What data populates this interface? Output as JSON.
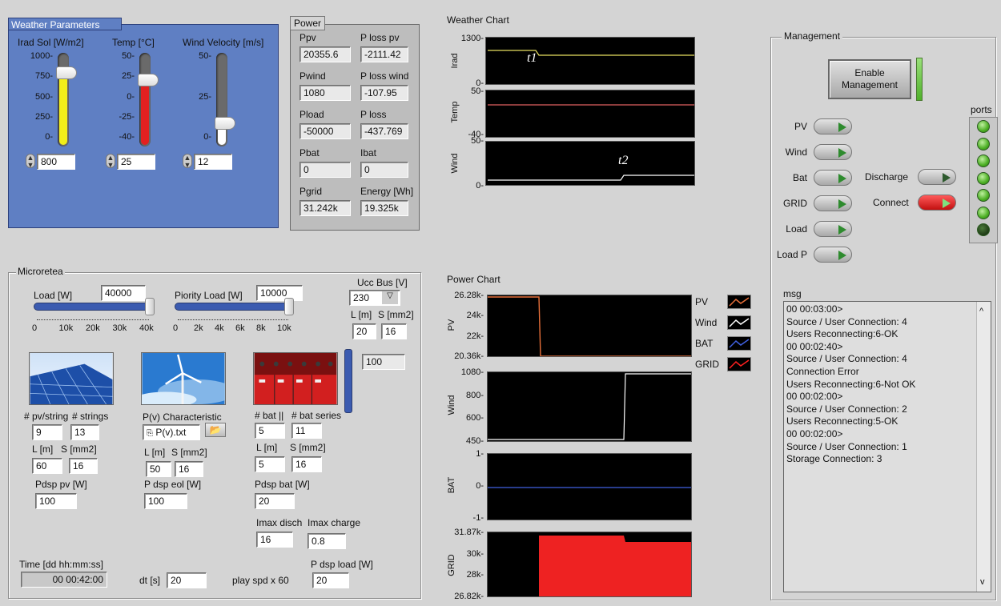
{
  "weather": {
    "title": "Weather Parameters",
    "irad": {
      "label": "Irad Sol [W/m2]",
      "value": "800",
      "ticks": [
        "1000-",
        "750-",
        "500-",
        "250-",
        "0-"
      ],
      "level": 0.8,
      "color": "#f2ef1a"
    },
    "temp": {
      "label": "Temp [°C]",
      "value": "25",
      "ticks": [
        "50-",
        "25-",
        "0-",
        "-25-",
        "-40-"
      ],
      "level": 0.72,
      "color": "#e22020"
    },
    "wind": {
      "label": "Wind Velocity [m/s]",
      "value": "12",
      "ticks": [
        "50-",
        "25-",
        "0-"
      ],
      "level": 0.24,
      "color": "#ffffff"
    }
  },
  "power": {
    "title": "Power",
    "items": [
      {
        "label": "Ppv",
        "value": "20355.6"
      },
      {
        "label": "P loss pv",
        "value": "-2111.42"
      },
      {
        "label": "Pwind",
        "value": "1080"
      },
      {
        "label": "P loss wind",
        "value": "-107.95"
      },
      {
        "label": "Pload",
        "value": "-50000"
      },
      {
        "label": "P loss",
        "value": "-437.769"
      },
      {
        "label": "Pbat",
        "value": "0"
      },
      {
        "label": "Ibat",
        "value": "0"
      },
      {
        "label": "Pgrid",
        "value": "31.242k"
      },
      {
        "label": "Energy [Wh]",
        "value": "19.325k"
      }
    ]
  },
  "weather_chart": {
    "title": "Weather Chart",
    "irad": {
      "ylabel": "Irad",
      "top": "1300-",
      "bottom": "0-",
      "annot": "t1",
      "color": "#e8e060"
    },
    "temp": {
      "ylabel": "Temp",
      "top": "50-",
      "bottom": "-40-",
      "color": "#e06060"
    },
    "wind": {
      "ylabel": "Wind",
      "top": "50-",
      "bottom": "0-",
      "annot": "t2",
      "color": "#ffffff"
    }
  },
  "management": {
    "title": "Management",
    "enable_label": "Enable Management",
    "ports_label": "ports",
    "sources": [
      "PV",
      "Wind",
      "Bat",
      "GRID",
      "Load",
      "Load P"
    ],
    "discharge_label": "Discharge",
    "connect_label": "Connect",
    "msg_label": "msg",
    "msg_lines": [
      "00 00:03:00>",
      "Source / User Connection: 4",
      "Users Reconnecting:6-OK",
      "00 00:02:40>",
      "Source / User Connection: 4",
      "Connection Error",
      "Users Reconnecting:6-Not OK",
      "00 00:02:00>",
      "Source / User Connection: 2",
      "Users Reconnecting:5-OK",
      "00 00:02:00>",
      "Source / User Connection: 1",
      "Storage Connection: 3"
    ],
    "scroll_up": "^",
    "scroll_down": "v"
  },
  "micro": {
    "title": "Microretea",
    "load_label": "Load [W]",
    "load_value": "40000",
    "load_level": 1.0,
    "load_ticks": [
      "0",
      "10k",
      "20k",
      "30k",
      "40k"
    ],
    "prio_label": "Piority Load [W]",
    "prio_value": "10000",
    "prio_level": 1.0,
    "prio_ticks": [
      "0",
      "2k",
      "4k",
      "6k",
      "8k",
      "10k"
    ],
    "ucc_label": "Ucc Bus [V]",
    "ucc_value": "230",
    "ucc_l_label": "L [m]",
    "ucc_s_label": "S [mm2]",
    "ucc_l": "20",
    "ucc_s": "16",
    "bat_level_value": "100",
    "pv_string_label": "# pv/string",
    "strings_label": "# strings",
    "pv_string": "9",
    "strings": "13",
    "pv_l_label": "L [m]",
    "pv_s_label": "S [mm2]",
    "pv_l": "60",
    "pv_s": "16",
    "pdsp_pv_label": "Pdsp pv [W]",
    "pdsp_pv": "100",
    "pv_char_label": "P(v) Characteristic",
    "pv_file": "P(v).txt",
    "eol_l_label": "L [m]",
    "eol_s_label": "S [mm2]",
    "eol_l": "50",
    "eol_s": "16",
    "pdsp_eol_label": "P dsp eol [W]",
    "pdsp_eol": "100",
    "bat_par_label": "# bat ||",
    "bat_ser_label": "# bat series",
    "bat_par": "5",
    "bat_ser": "11",
    "bat_l_label": "L [m]",
    "bat_s_label": "S [mm2]",
    "bat_l": "5",
    "bat_s": "16",
    "pdsp_bat_label": "Pdsp bat [W]",
    "pdsp_bat": "20",
    "imax_disch_label": "Imax disch",
    "imax_charge_label": "Imax charge",
    "imax_disch": "16",
    "imax_charge": "0.8",
    "time_label": "Time  [dd hh:mm:ss]",
    "time_value": "00 00:42:00",
    "dt_label": "dt [s]",
    "dt_value": "20",
    "play_label": "play spd   x 60",
    "pdsp_load_label": "P dsp load [W]",
    "pdsp_load": "20"
  },
  "power_chart": {
    "title": "Power Chart",
    "pv": {
      "ylabel": "PV",
      "ticks": [
        "26.28k-",
        "24k-",
        "22k-",
        "20.36k-"
      ]
    },
    "wind": {
      "ylabel": "Wind",
      "ticks": [
        "1080-",
        "800-",
        "600-",
        "450-"
      ]
    },
    "bat": {
      "ylabel": "BAT",
      "ticks": [
        "1-",
        "0-",
        "-1-"
      ]
    },
    "grid": {
      "ylabel": "GRID",
      "ticks": [
        "31.87k-",
        "30k-",
        "28k-",
        "26.82k-"
      ]
    },
    "legend": [
      {
        "label": "PV",
        "color": "#e8703a"
      },
      {
        "label": "Wind",
        "color": "#ffffff"
      },
      {
        "label": "BAT",
        "color": "#4060e0"
      },
      {
        "label": "GRID",
        "color": "#ff2020"
      }
    ]
  }
}
